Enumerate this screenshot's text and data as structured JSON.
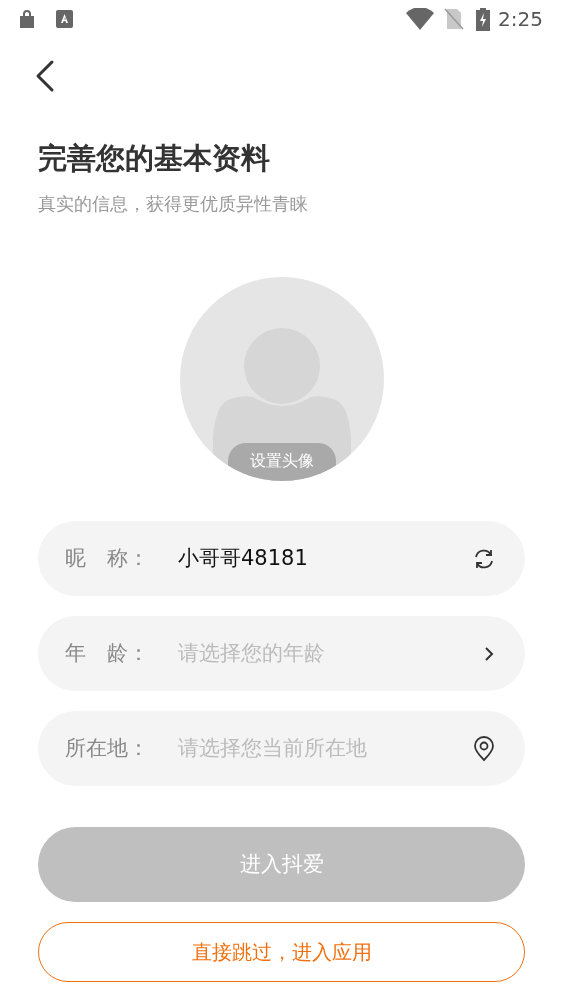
{
  "status_bar": {
    "time": "2:25"
  },
  "title": "完善您的基本资料",
  "subtitle": "真实的信息，获得更优质异性青睐",
  "avatar": {
    "label": "设置头像"
  },
  "fields": [
    {
      "kind": "refresh",
      "label": "昵　称：",
      "value": "小哥哥48181"
    },
    {
      "kind": "select",
      "label": "年　龄：",
      "placeholder": "请选择您的年龄"
    },
    {
      "kind": "location",
      "label": "所在地：",
      "placeholder": "请选择您当前所在地"
    }
  ],
  "submit_button": {
    "label": "进入抖爱",
    "disabled": true
  },
  "skip_button": {
    "label": "直接跳过，进入应用"
  }
}
